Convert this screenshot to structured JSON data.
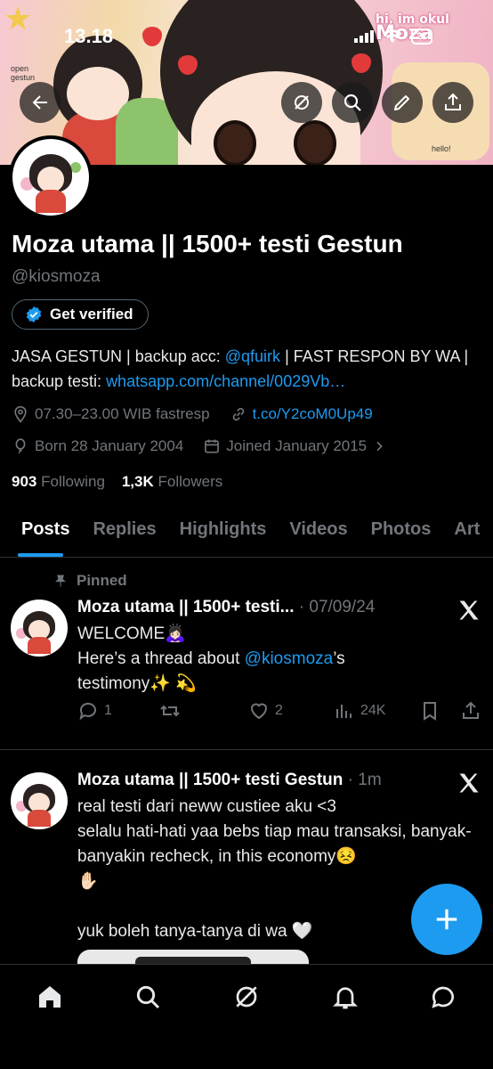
{
  "status_bar": {
    "time": "13.18",
    "battery": "27"
  },
  "banner": {
    "corner_text": "open gestun",
    "logo_small": "hi, im okul",
    "logo_big": "Moza",
    "hello_text": "hello!"
  },
  "profile": {
    "display_name": "Moza utama || 1500+ testi Gestun",
    "handle": "@kiosmoza",
    "get_verified_label": "Get verified",
    "bio_part1": "JASA GESTUN | backup acc: ",
    "bio_mention": "@qfuirk",
    "bio_part2": " | FAST RESPON BY WA | backup testi: ",
    "bio_link": "whatsapp.com/channel/0029Vb…",
    "location": "07.30–23.00 WIB fastresp",
    "website": "t.co/Y2coM0Up49",
    "born": "Born 28 January 2004",
    "joined": "Joined January 2015",
    "following_count": "903",
    "following_label": "Following",
    "followers_count": "1,3K",
    "followers_label": "Followers"
  },
  "tabs": [
    {
      "label": "Posts"
    },
    {
      "label": "Replies"
    },
    {
      "label": "Highlights"
    },
    {
      "label": "Videos"
    },
    {
      "label": "Photos"
    },
    {
      "label": "Art"
    }
  ],
  "posts": [
    {
      "pinned_label": "Pinned",
      "author": "Moza utama || 1500+ testi...",
      "time": "· 07/09/24",
      "text_line1": "WELCOME🙇🏻‍♀️",
      "text_line2_pre": "Here’s a thread about ",
      "text_mention": "@kiosmoza",
      "text_line2_post": "’s",
      "text_line3": "testimony✨ 💫",
      "replies": "1",
      "reposts": "",
      "likes": "2",
      "views": "24K"
    },
    {
      "author": "Moza utama || 1500+ testi Gestun",
      "time": "· 1m",
      "text": "real testi dari neww custiee aku <3\nselalu hati-hati yaa bebs tiap mau transaksi, banyak-banyakin recheck, in this economy😣\n✋🏻\n\nyuk boleh tanya-tanya di wa 🤍"
    }
  ],
  "colors": {
    "accent": "#1d9bf0",
    "background": "#000000",
    "muted": "#71767b"
  },
  "icons": [
    "back-arrow-icon",
    "grok-icon",
    "search-icon",
    "edit-icon",
    "share-icon",
    "verified-badge-icon",
    "location-icon",
    "link-icon",
    "balloon-icon",
    "calendar-icon",
    "pin-icon",
    "x-logo-icon",
    "reply-icon",
    "repost-icon",
    "like-icon",
    "views-icon",
    "bookmark-icon",
    "compose-plus-icon",
    "home-icon",
    "explore-icon",
    "notifications-icon",
    "messages-icon"
  ]
}
